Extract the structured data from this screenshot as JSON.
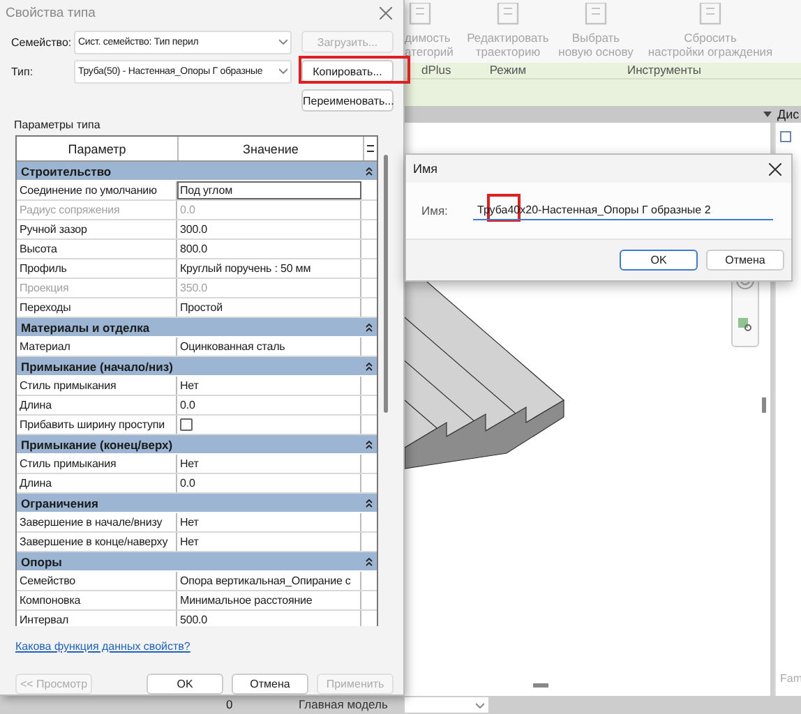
{
  "app": {
    "ribbon_buttons": [
      {
        "lines": [
          "димость",
          "атегорий"
        ]
      },
      {
        "lines": [
          "Редактировать",
          "траекторию"
        ]
      },
      {
        "lines": [
          "Выбрать",
          "новую основу"
        ]
      },
      {
        "lines": [
          "Сбросить",
          "настройки ограждения"
        ]
      }
    ],
    "ribbon_panels": [
      "dPlus",
      "Режим",
      "Инструменты"
    ],
    "side_panel": {
      "title": "Дис",
      "footer": "Fam"
    },
    "status_bar": {
      "workset": "0",
      "model": "Главная модель"
    }
  },
  "type_dialog": {
    "title": "Свойства типа",
    "family": {
      "label": "Семейство:",
      "value": "Сист. семейство: Тип перил"
    },
    "type": {
      "label": "Тип:",
      "value": "Труба(50) - Настенная_Опоры Г образные"
    },
    "side_buttons": [
      {
        "label": "Загрузить...",
        "disabled": true,
        "highlighted": false
      },
      {
        "label": "Копировать...",
        "disabled": false,
        "highlighted": true
      },
      {
        "label": "Переименовать...",
        "disabled": false,
        "highlighted": false
      }
    ],
    "section_label": "Параметры типа",
    "columns": [
      "Параметр",
      "Значение"
    ],
    "groups": [
      {
        "title": "Строительство",
        "rows": [
          {
            "kind": "text",
            "param": "Соединение по умолчанию",
            "value": "Под углом",
            "disabled": false,
            "selected": true
          },
          {
            "kind": "text",
            "param": "Радиус сопряжения",
            "value": "0.0",
            "disabled": true,
            "selected": false
          },
          {
            "kind": "text",
            "param": "Ручной зазор",
            "value": "300.0",
            "disabled": false,
            "selected": false
          },
          {
            "kind": "text",
            "param": "Высота",
            "value": "800.0",
            "disabled": false,
            "selected": false
          },
          {
            "kind": "text",
            "param": "Профиль",
            "value": "Круглый поручень : 50 мм",
            "disabled": false,
            "selected": false
          },
          {
            "kind": "text",
            "param": "Проекция",
            "value": "350.0",
            "disabled": true,
            "selected": false
          },
          {
            "kind": "text",
            "param": "Переходы",
            "value": "Простой",
            "disabled": false,
            "selected": false
          }
        ]
      },
      {
        "title": "Материалы и отделка",
        "rows": [
          {
            "kind": "text",
            "param": "Материал",
            "value": "Оцинкованная сталь",
            "disabled": false,
            "selected": false
          }
        ]
      },
      {
        "title": "Примыкание (начало/низ)",
        "rows": [
          {
            "kind": "text",
            "param": "Стиль примыкания",
            "value": "Нет",
            "disabled": false,
            "selected": false
          },
          {
            "kind": "text",
            "param": "Длина",
            "value": "0.0",
            "disabled": false,
            "selected": false
          },
          {
            "kind": "checkbox",
            "param": "Прибавить ширину проступи",
            "checked": false,
            "disabled": false,
            "selected": false
          }
        ]
      },
      {
        "title": "Примыкание (конец/верх)",
        "rows": [
          {
            "kind": "text",
            "param": "Стиль примыкания",
            "value": "Нет",
            "disabled": false,
            "selected": false
          },
          {
            "kind": "text",
            "param": "Длина",
            "value": "0.0",
            "disabled": false,
            "selected": false
          }
        ]
      },
      {
        "title": "Ограничения",
        "rows": [
          {
            "kind": "text",
            "param": "Завершение в начале/внизу",
            "value": "Нет",
            "disabled": false,
            "selected": false
          },
          {
            "kind": "text",
            "param": "Завершение в конце/наверху",
            "value": "Нет",
            "disabled": false,
            "selected": false
          }
        ]
      },
      {
        "title": "Опоры",
        "rows": [
          {
            "kind": "text",
            "param": "Семейство",
            "value": "Опора вертикальная_Опирание с",
            "disabled": false,
            "selected": false
          },
          {
            "kind": "text",
            "param": "Компоновка",
            "value": "Минимальное расстояние",
            "disabled": false,
            "selected": false
          },
          {
            "kind": "text",
            "param": "Интервал",
            "value": "500.0",
            "disabled": false,
            "selected": false
          }
        ]
      }
    ],
    "help_link": "Какова функция данных свойств?",
    "buttons": [
      {
        "label": "<< Просмотр",
        "disabled": true
      },
      {
        "label": "OK",
        "disabled": false
      },
      {
        "label": "Отмена",
        "disabled": false
      },
      {
        "label": "Применить",
        "disabled": true
      }
    ]
  },
  "name_dialog": {
    "title": "Имя",
    "label": "Имя:",
    "value": "Труба40x20-Настенная_Опоры Г образные 2",
    "buttons": [
      {
        "label": "OK",
        "default": true
      },
      {
        "label": "Отмена",
        "default": false
      }
    ]
  }
}
